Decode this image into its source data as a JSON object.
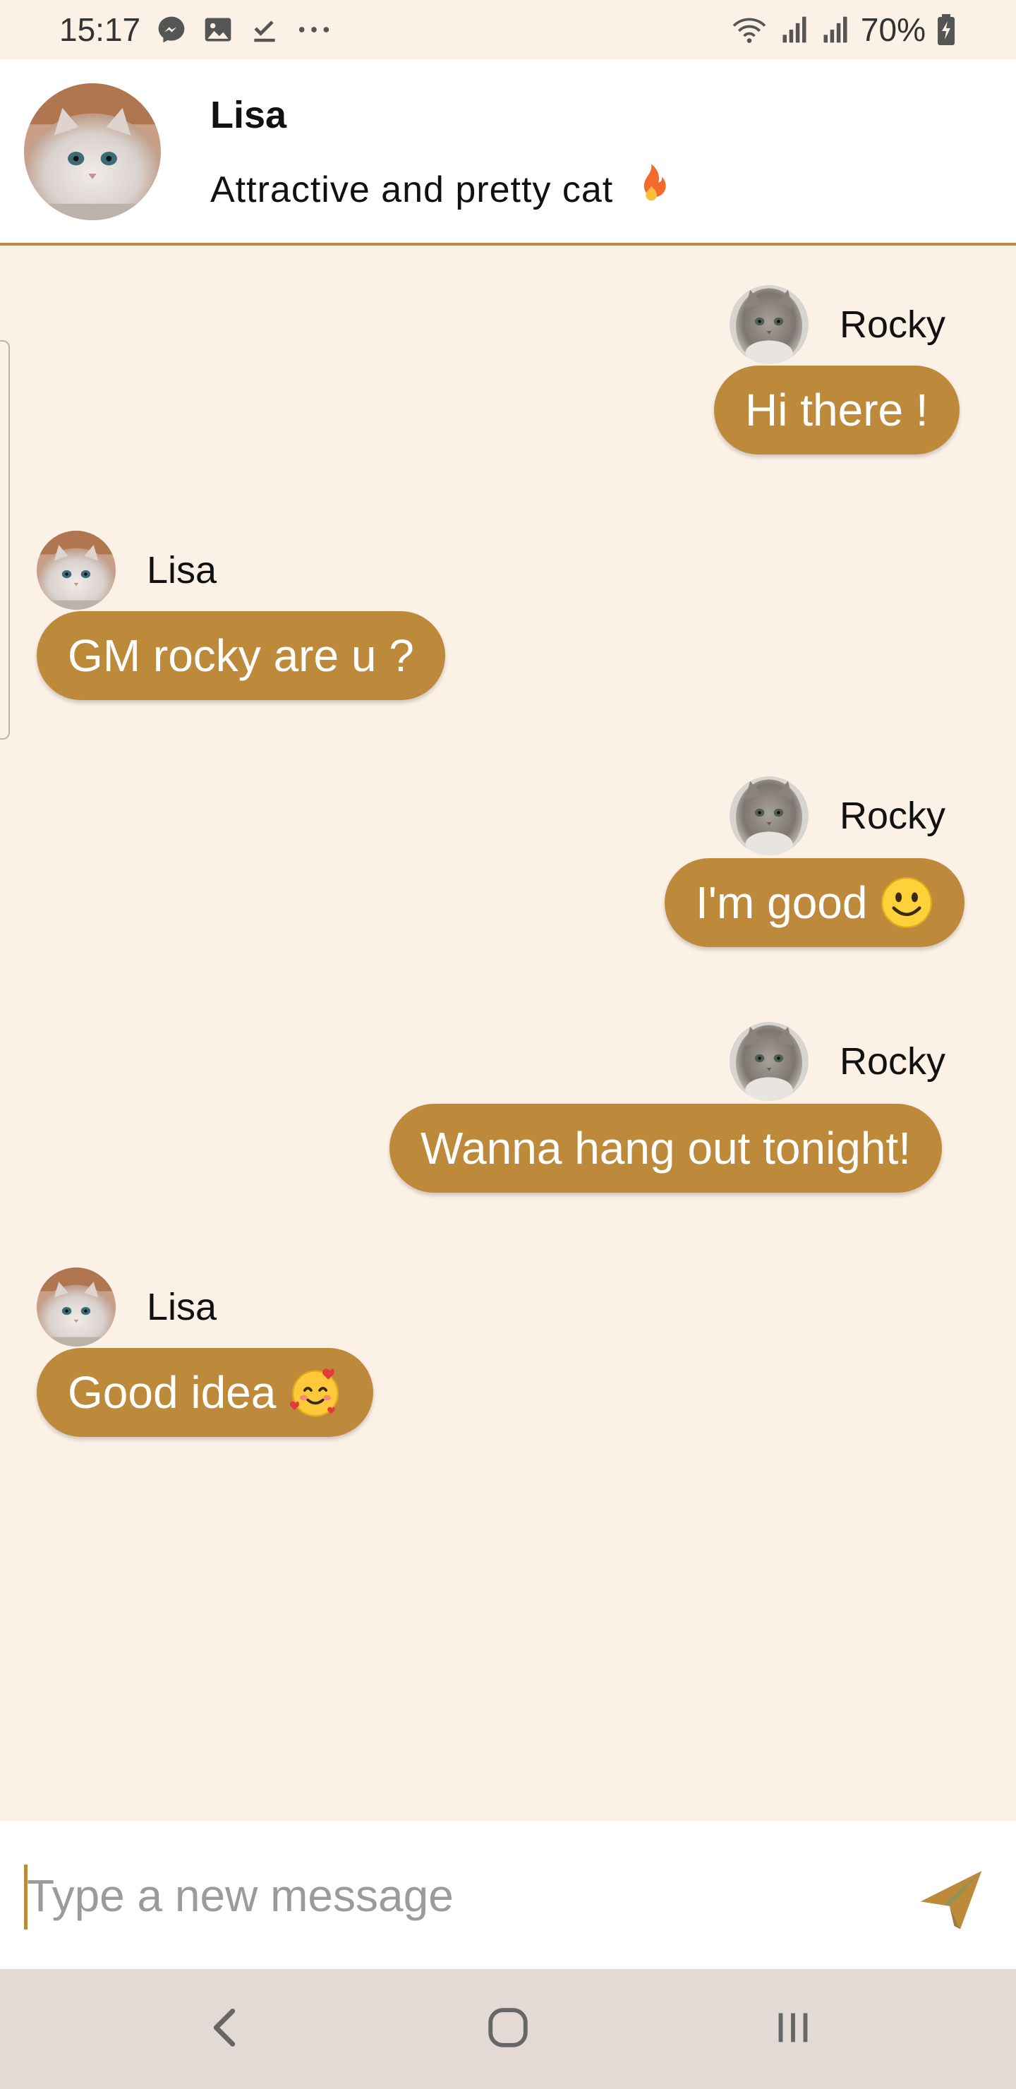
{
  "status_bar": {
    "time": "15:17",
    "battery": "70%"
  },
  "header": {
    "name": "Lisa",
    "status": "Attractive and pretty cat"
  },
  "messages": [
    {
      "sender": "Rocky",
      "text": "Hi there !"
    },
    {
      "sender": "Lisa",
      "text": "GM rocky are u ?"
    },
    {
      "sender": "Rocky",
      "text": "I'm good"
    },
    {
      "sender": "Rocky",
      "text": "Wanna hang out tonight!"
    },
    {
      "sender": "Lisa",
      "text": "Good idea"
    }
  ],
  "composer": {
    "placeholder": "Type a new message",
    "value": ""
  },
  "icons": {
    "status_bar_left": [
      "messenger-icon",
      "gallery-icon",
      "download-done-icon",
      "more-dots-icon"
    ],
    "status_bar_right": [
      "wifi-icon",
      "signal-icon",
      "signal-icon",
      "battery-charging-icon"
    ],
    "header_status_emoji": "fire-emoji",
    "message_emojis": {
      "2": "smiling-face-emoji",
      "4": "smiling-face-with-hearts-emoji"
    },
    "send": "send-icon",
    "nav": [
      "back-icon",
      "home-icon",
      "recents-icon"
    ]
  },
  "colors": {
    "accent": "#bd8a3b",
    "background": "#fcf1e6",
    "divider": "#c08a3e",
    "navbar": "#e3dad6"
  }
}
